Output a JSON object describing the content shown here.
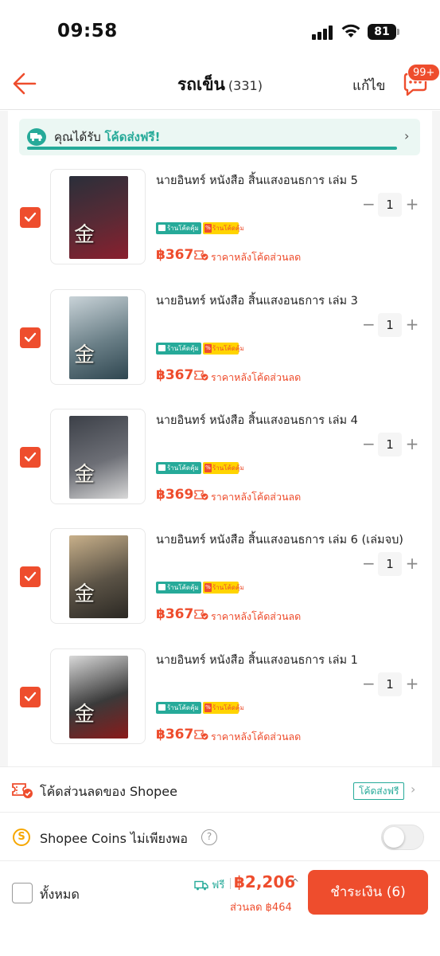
{
  "status_bar": {
    "time": "09:58",
    "battery": "81"
  },
  "header": {
    "title": "รถเข็น",
    "count": "(331)",
    "edit_label": "แก้ไข",
    "chat_badge": "99+"
  },
  "promo": {
    "text_prefix": "คุณได้รับ",
    "text_highlight": "โค้ดส่งฟรี!",
    "chevron": "›"
  },
  "items": [
    {
      "title": "นายอินทร์ หนังสือ สิ้นแสงอนธการ เล่ม 5",
      "qty": "1",
      "price": "฿367",
      "note": "ราคาหลังโค้ดส่วนลด",
      "badge_green": "ร้านโค้ดคุ้ม",
      "badge_yellow": "ร้านโค้ดคุ้ม",
      "cover_colors": [
        "#2a2f3a",
        "#5a2a35",
        "#8a1f2e"
      ]
    },
    {
      "title": "นายอินทร์ หนังสือ สิ้นแสงอนธการ เล่ม 3",
      "qty": "1",
      "price": "฿367",
      "note": "ราคาหลังโค้ดส่วนลด",
      "badge_green": "ร้านโค้ดคุ้ม",
      "badge_yellow": "ร้านโค้ดคุ้ม",
      "cover_colors": [
        "#c9d3d8",
        "#6a7f87",
        "#2f4650"
      ]
    },
    {
      "title": "นายอินทร์ หนังสือ สิ้นแสงอนธการ เล่ม 4",
      "qty": "1",
      "price": "฿369",
      "note": "ราคาหลังโค้ดส่วนลด",
      "badge_green": "ร้านโค้ดคุ้ม",
      "badge_yellow": "ร้านโค้ดคุ้ม",
      "cover_colors": [
        "#3c4048",
        "#6d6f76",
        "#d8d8d8"
      ]
    },
    {
      "title": "นายอินทร์ หนังสือ สิ้นแสงอนธการ เล่ม 6 (เล่มจบ)",
      "qty": "1",
      "price": "฿367",
      "note": "ราคาหลังโค้ดส่วนลด",
      "badge_green": "ร้านโค้ดคุ้ม",
      "badge_yellow": "ร้านโค้ดคุ้ม",
      "cover_colors": [
        "#c8b08a",
        "#5b5346",
        "#2b2823"
      ]
    },
    {
      "title": "นายอินทร์ หนังสือ สิ้นแสงอนธการ เล่ม 1",
      "qty": "1",
      "price": "฿367",
      "note": "ราคาหลังโค้ดส่วนลด",
      "badge_green": "ร้านโค้ดคุ้ม",
      "badge_yellow": "ร้านโค้ดคุ้ม",
      "cover_colors": [
        "#d9d9d9",
        "#3a3a3a",
        "#8a1a1a"
      ]
    }
  ],
  "voucher_row": {
    "label": "โค้ดส่วนลดของ Shopee",
    "tag": "โค้ดส่งฟรี",
    "chevron": "›"
  },
  "coins_row": {
    "label": "Shopee Coins ไม่เพียงพอ",
    "coin_symbol": "S",
    "help_symbol": "?"
  },
  "footer": {
    "all_label": "ทั้งหมด",
    "ship_label": "ฟรี",
    "total": "฿2,206",
    "caret": "^",
    "saved": "ส่วนลด ฿464",
    "checkout_label": "ชำระเงิน (6)"
  },
  "colors": {
    "accent": "#ee4d2d",
    "green": "#26aa99",
    "yellow": "#ffd400"
  },
  "icons": [
    "back-arrow-icon",
    "chat-icon",
    "truck-icon",
    "check-icon",
    "voucher-icon",
    "coin-icon",
    "help-icon"
  ]
}
